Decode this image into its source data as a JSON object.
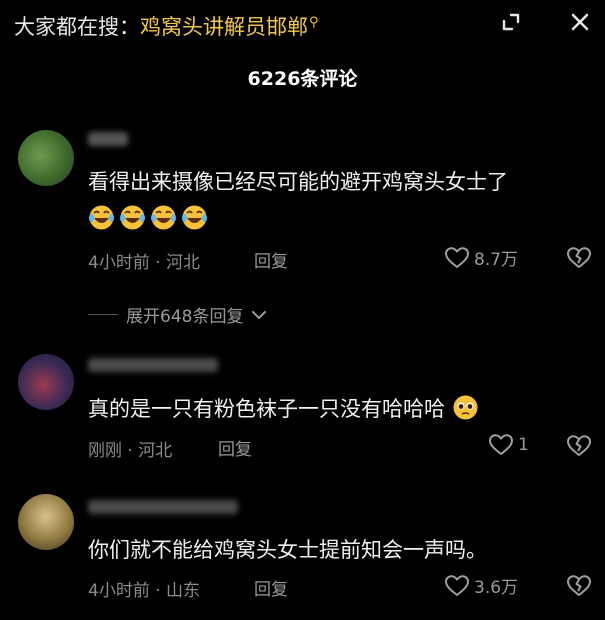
{
  "header": {
    "search_prefix": "大家都在搜：",
    "search_term": "鸡窝头讲解员邯郸",
    "search_glyph": "⚲",
    "minimize_icon": "collapse-icon",
    "close_icon": "close-icon"
  },
  "comments_panel": {
    "count_label": "6226条评论"
  },
  "comments": [
    {
      "text": "看得出来摄像已经尽可能的避开鸡窝头女士了",
      "emoji_count": 4,
      "emoji_icon": "laughing-tears-emoji",
      "meta": "4小时前 · 河北",
      "reply_label": "回复",
      "likes": "8.7万",
      "expand_label": "展开648条回复",
      "avatar_color": "#4f7a3a"
    },
    {
      "text": "真的是一只有粉色袜子一只没有哈哈哈",
      "trailing_emoji": "pleading-face-emoji",
      "meta": "刚刚 · 河北",
      "reply_label": "回复",
      "likes": "1",
      "avatar_color": "#7a3a4a"
    },
    {
      "text": "你们就不能给鸡窝头女士提前知会一声吗。",
      "meta": "4小时前 · 山东",
      "reply_label": "回复",
      "likes": "3.6万",
      "avatar_color": "#8a7a3a"
    }
  ]
}
